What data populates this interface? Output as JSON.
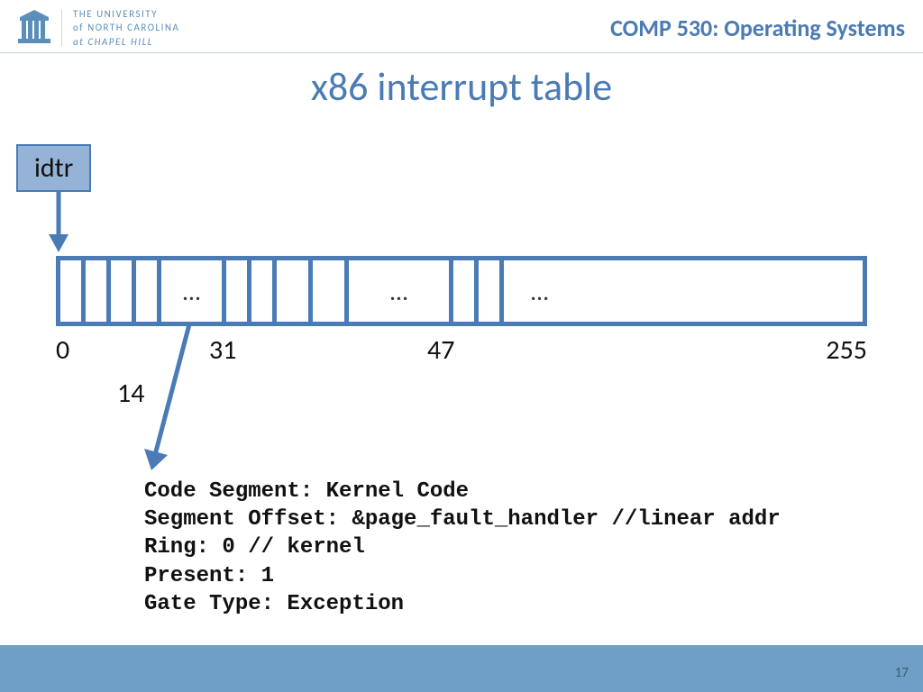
{
  "header": {
    "uni_line1": "THE UNIVERSITY",
    "uni_line2": "of NORTH CAROLINA",
    "uni_line3": "at CHAPEL HILL",
    "course": "COMP 530: Operating Systems"
  },
  "slide": {
    "title": "x86 interrupt table",
    "idtr": "idtr",
    "ellipsis": "…",
    "axis": {
      "v0": "0",
      "v31": "31",
      "v47": "47",
      "v255": "255",
      "v14": "14"
    },
    "code": {
      "l1": "Code Segment: Kernel Code",
      "l2": "Segment Offset: &page_fault_handler //linear addr",
      "l3": "Ring: 0 // kernel",
      "l4": "Present: 1",
      "l5": "Gate Type: Exception"
    },
    "page": "17"
  },
  "colors": {
    "accent": "#4a7bb5",
    "box": "#95b3d7",
    "footer": "#6e9fc4"
  }
}
